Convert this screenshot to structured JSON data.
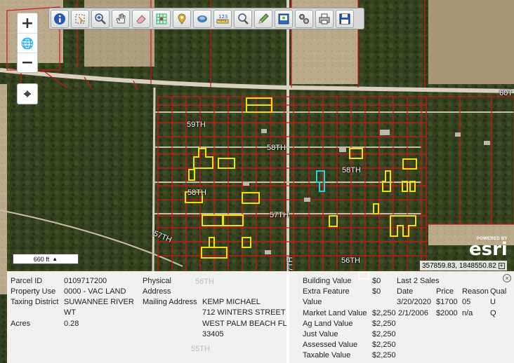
{
  "map": {
    "roads": [
      "60T",
      "59TH",
      "58TH",
      "58TH",
      "58TH",
      "57TH",
      "57TH",
      "56TH",
      "97TH",
      "56TH",
      "55TH"
    ],
    "scale_label": "660 ft",
    "coordinates": "357859.83, 1848550.82",
    "attribution": {
      "powered": "POWERED BY",
      "brand": "esri"
    }
  },
  "zoom": {
    "in": "+",
    "globe": "🌐",
    "out": "−",
    "locate": "⌖"
  },
  "toolbar": {
    "tools": [
      "info-icon",
      "select-icon",
      "zoom-in-icon",
      "pan-icon",
      "eraser-icon",
      "grid-icon",
      "pin-icon",
      "layers-icon",
      "measure-icon",
      "search-icon",
      "pencil-icon",
      "print-map-icon",
      "settings-icon",
      "printer-icon",
      "save-icon"
    ]
  },
  "parcel": {
    "parcel_id_label": "Parcel ID",
    "parcel_id": "0109717200",
    "property_use_label": "Property Use",
    "property_use": "0000 - VAC LAND",
    "taxing_district_label": "Taxing District",
    "taxing_district_1": "SUWANNEE RIVER",
    "taxing_district_2": "WT",
    "acres_label": "Acres",
    "acres": "0.28",
    "physical_label": "Physical",
    "address_label": "Address",
    "mailing_label": "Mailing Address",
    "mailing_1": "KEMP MICHAEL",
    "mailing_2": "712 WINTERS STREET",
    "mailing_3": "WEST PALM BEACH FL",
    "mailing_4": "33405"
  },
  "values": {
    "building_value_label": "Building Value",
    "building_value": "$0",
    "extra_feature_label": "Extra Feature",
    "extra_feature": "$0",
    "value_label": "Value",
    "market_land_label": "Market Land Value",
    "market_land": "$2,250",
    "ag_land_label": "Ag Land Value",
    "ag_land": "$2,250",
    "just_value_label": "Just Value",
    "just_value": "$2,250",
    "assessed_label": "Assessed Value",
    "assessed": "$2,250",
    "taxable_label": "Taxable Value",
    "taxable": "$2,250"
  },
  "sales": {
    "title": "Last 2 Sales",
    "headers": [
      "Date",
      "Price",
      "Reason",
      "Qual"
    ],
    "rows": [
      [
        "3/20/2020",
        "$1700",
        "05",
        "U"
      ],
      [
        "2/1/2006",
        "$2000",
        "n/a",
        "Q"
      ]
    ]
  },
  "close_label": "×"
}
